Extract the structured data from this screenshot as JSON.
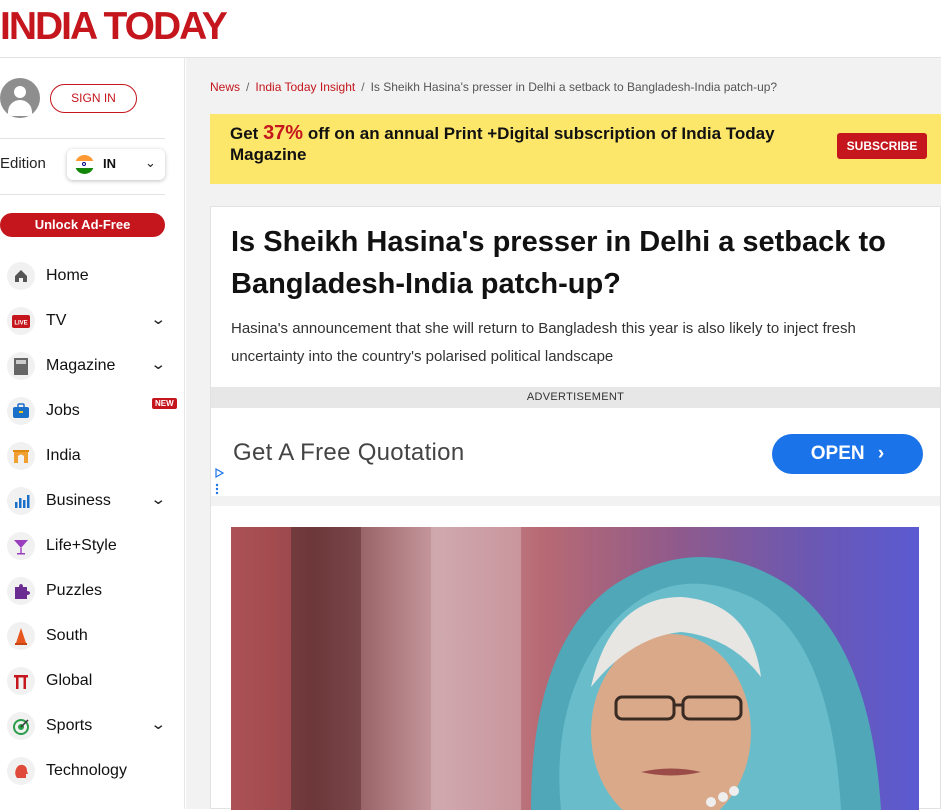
{
  "header": {
    "logo": "INDIA TODAY"
  },
  "sidebar": {
    "signin_label": "SIGN IN",
    "edition_label": "Edition",
    "edition_value": "IN",
    "unlock_label": "Unlock Ad-Free",
    "new_badge": "NEW",
    "items": [
      {
        "label": "Home",
        "icon": "home-icon",
        "chevron": false
      },
      {
        "label": "TV",
        "icon": "live-tv-icon",
        "chevron": true
      },
      {
        "label": "Magazine",
        "icon": "magazine-icon",
        "chevron": true
      },
      {
        "label": "Jobs",
        "icon": "briefcase-icon",
        "chevron": false,
        "badge": true
      },
      {
        "label": "India",
        "icon": "india-gate-icon",
        "chevron": false
      },
      {
        "label": "Business",
        "icon": "bar-chart-icon",
        "chevron": true
      },
      {
        "label": "Life+Style",
        "icon": "cocktail-icon",
        "chevron": false
      },
      {
        "label": "Puzzles",
        "icon": "puzzle-icon",
        "chevron": false
      },
      {
        "label": "South",
        "icon": "temple-icon",
        "chevron": false
      },
      {
        "label": "Global",
        "icon": "torii-gate-icon",
        "chevron": false
      },
      {
        "label": "Sports",
        "icon": "target-icon",
        "chevron": true
      },
      {
        "label": "Technology",
        "icon": "brain-icon",
        "chevron": false
      }
    ]
  },
  "breadcrumb": {
    "item1": "News",
    "item2": "India Today Insight",
    "item3": "Is Sheikh Hasina's presser in Delhi a setback to Bangladesh-India patch-up?",
    "sep": "/"
  },
  "promo": {
    "pre": "Get ",
    "pct": "37%",
    "post": " off on an annual Print +Digital subscription of India Today Magazine",
    "button": "SUBSCRIBE"
  },
  "article": {
    "headline": "Is Sheikh Hasina's presser in Delhi a setback to Bangladesh-India patch-up?",
    "deck": "Hasina's announcement that she will return to Bangladesh this year is also likely to inject fresh uncertainty into the country's polarised political landscape"
  },
  "ad": {
    "band_label": "ADVERTISEMENT",
    "text": "Get A Free Quotation",
    "button": "OPEN"
  },
  "colors": {
    "brand_red": "#c4161c",
    "promo_yellow": "#fde76b",
    "ad_blue": "#1a73e8"
  }
}
